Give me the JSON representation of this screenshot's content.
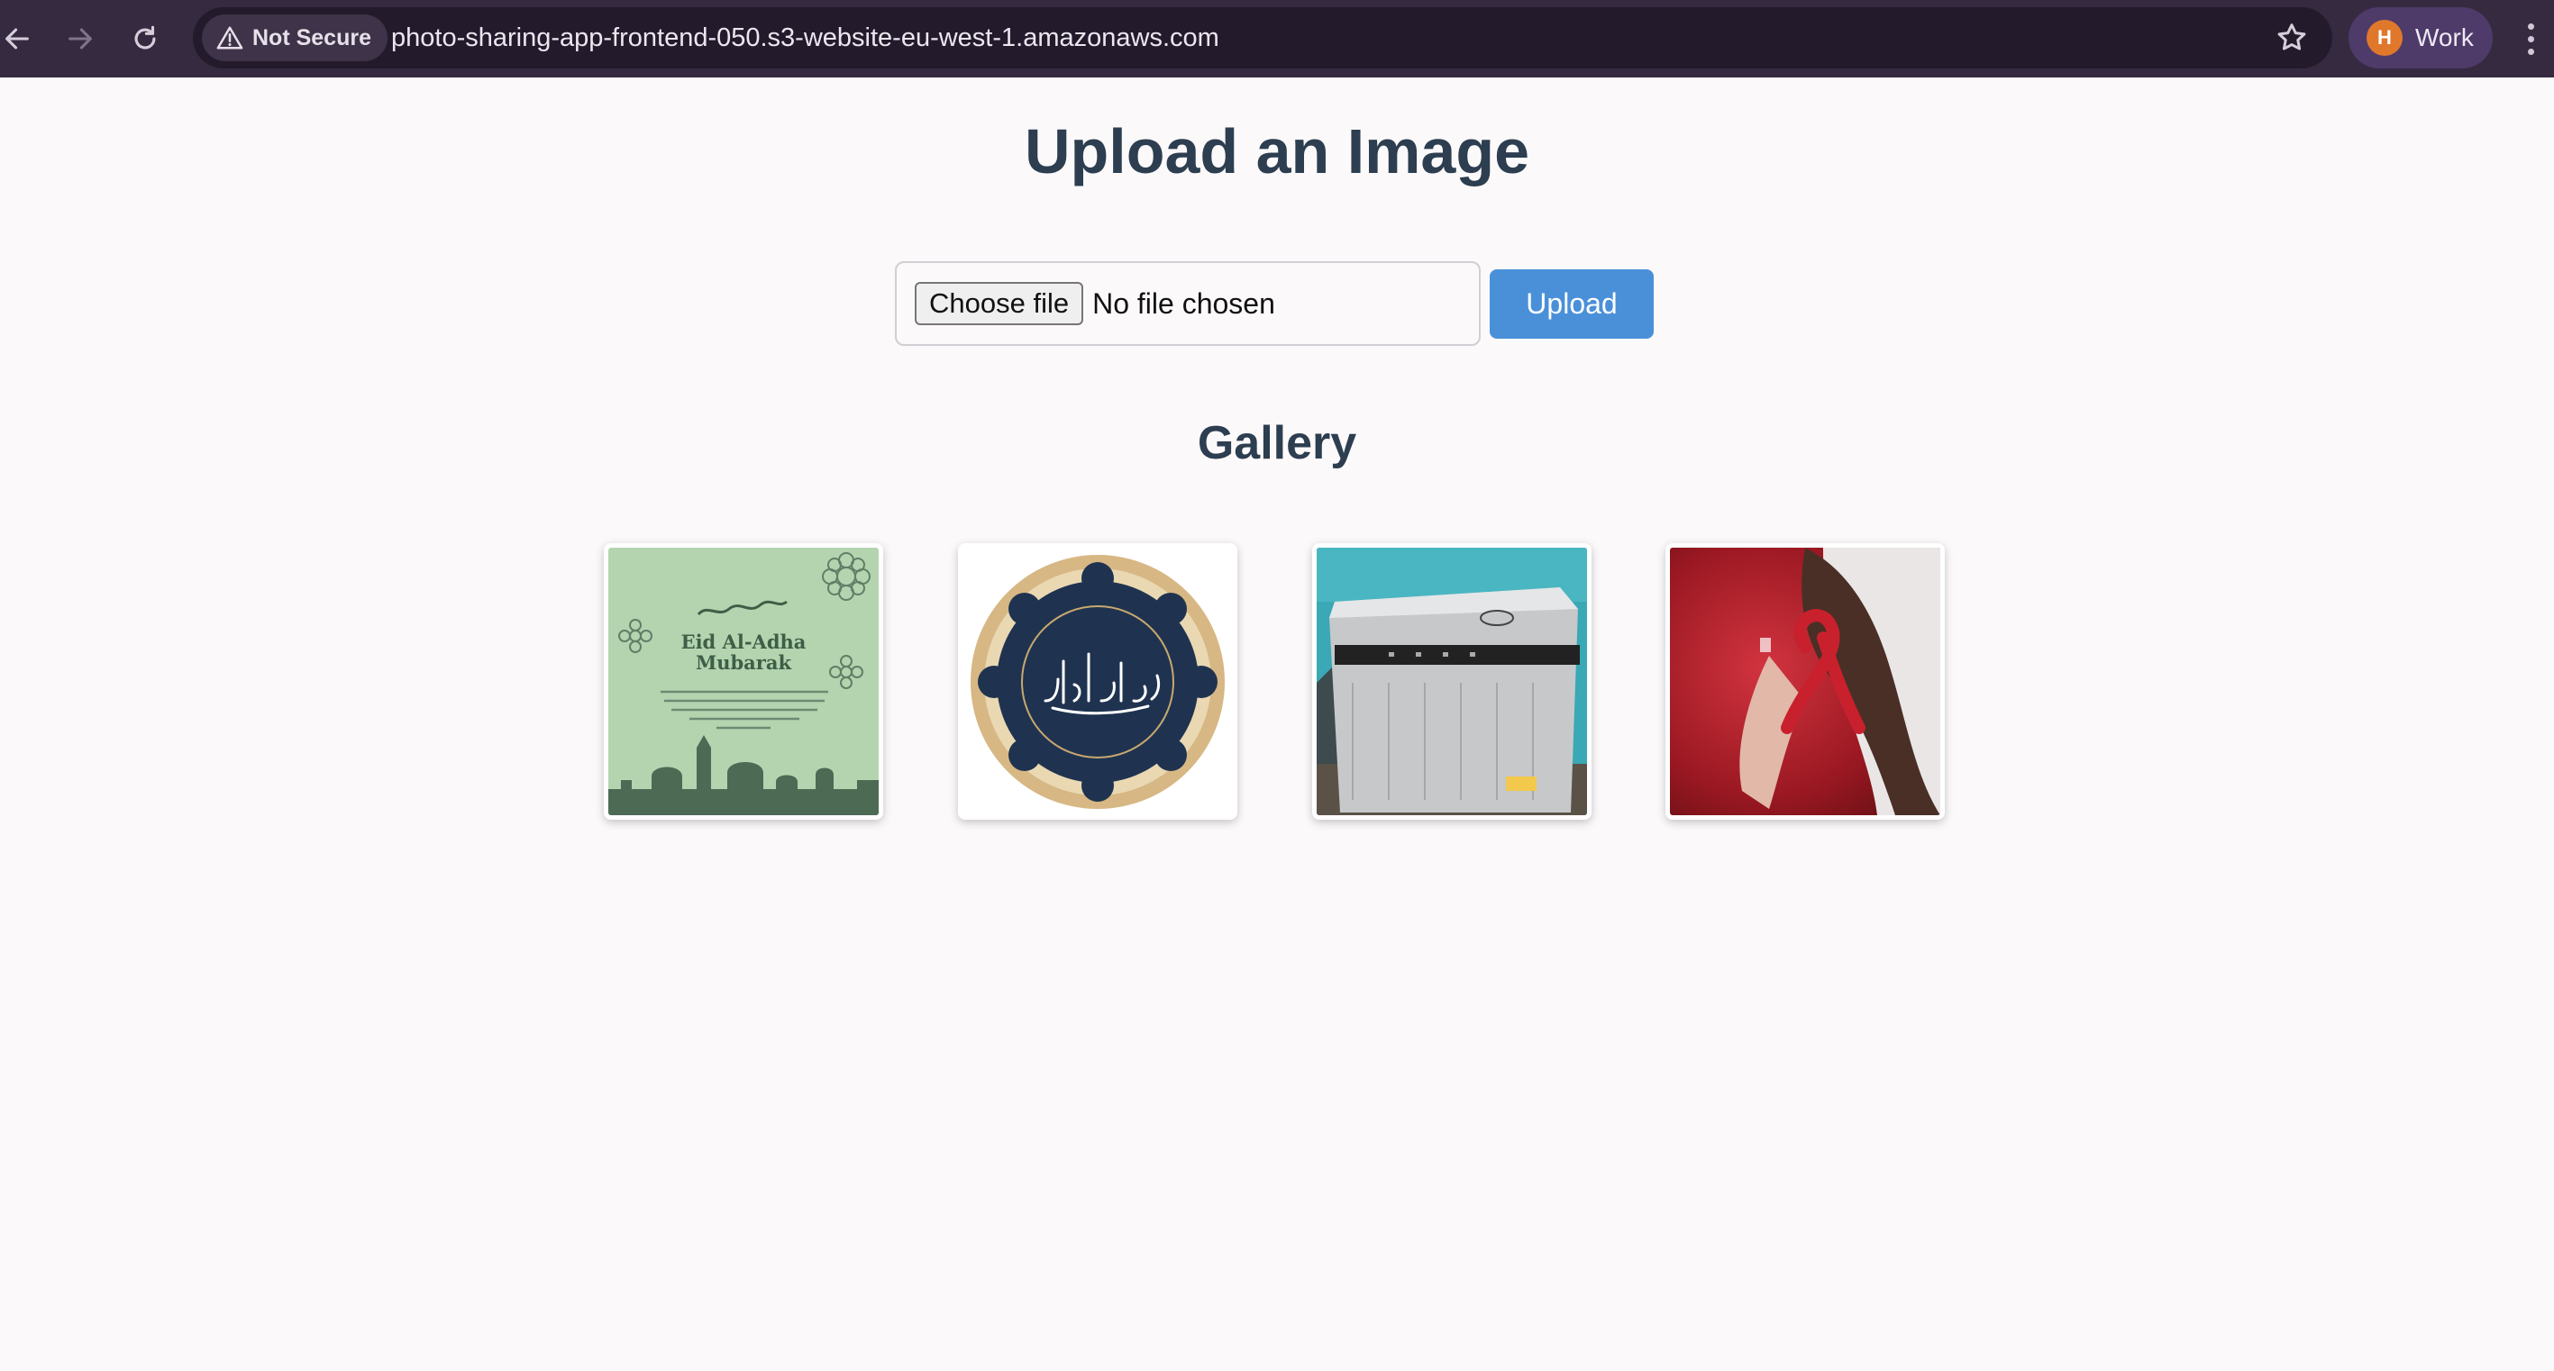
{
  "browser": {
    "security_label": "Not Secure",
    "url": "photo-sharing-app-frontend-050.s3-website-eu-west-1.amazonaws.com",
    "profile_initial": "H",
    "profile_name": "Work",
    "icons": [
      "back-icon",
      "forward-icon",
      "reload-icon",
      "warning-icon",
      "star-icon",
      "more-icon"
    ]
  },
  "page": {
    "title": "Upload an Image",
    "file_input": {
      "button_label": "Choose file",
      "status": "No file chosen"
    },
    "upload_label": "Upload",
    "gallery_title": "Gallery"
  },
  "gallery": {
    "images": [
      {
        "name": "eid-card-image",
        "card_heading": "Eid Al-Adha",
        "card_subheading": "Mubarak"
      },
      {
        "name": "quran-calligraphy-image"
      },
      {
        "name": "dishwasher-image"
      },
      {
        "name": "red-ribbon-image"
      }
    ]
  },
  "colors": {
    "chrome_bg": "#352a40",
    "page_bg": "#fcf9fa",
    "heading": "#2c3e50",
    "upload_button": "#4a90d9",
    "avatar": "#e0782c"
  }
}
